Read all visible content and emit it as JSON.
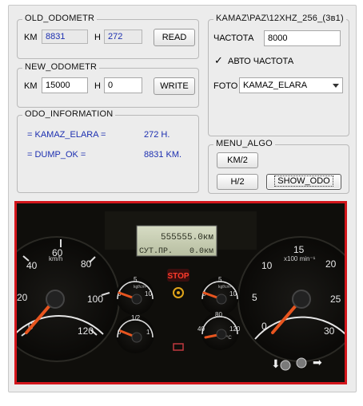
{
  "old_odometr": {
    "title": "OLD_ODOMETR",
    "km_label": "KM",
    "km_value": "8831",
    "h_label": "H",
    "h_value": "272",
    "read_button": "READ"
  },
  "new_odometr": {
    "title": "NEW_ODOMETR",
    "km_label": "KM",
    "km_value": "15000",
    "h_label": "H",
    "h_value": "0",
    "write_button": "WRITE"
  },
  "odo_information": {
    "title": "ODO_INFORMATION",
    "rows": [
      {
        "label": "= KAMAZ_ELARA =",
        "value": "272 H."
      },
      {
        "label": "= DUMP_OK =",
        "value": "8831 KM."
      }
    ]
  },
  "device": {
    "title": "KAMAZ\\PAZ\\12XHZ_256_(3в1)",
    "freq_label": "ЧАСТОТА",
    "freq_value": "8000",
    "auto_freq_label": "АВТО ЧАСТОТА",
    "auto_freq_checked": true,
    "foto_label": "FOTO",
    "foto_selected": "KAMAZ_ELARA"
  },
  "menu_algo": {
    "title": "MENU_ALGO",
    "km2_button": "KM/2",
    "h2_button": "H/2",
    "show_odo_button": "SHOW_ODO"
  },
  "dashboard": {
    "lcd_line1": "555555.0км",
    "lcd_line2_label": "СУТ.ПР.",
    "lcd_line2_value": "0.0км",
    "speed_unit": "km/h",
    "speed_ticks": [
      "0",
      "20",
      "40",
      "60",
      "80",
      "100",
      "120"
    ],
    "tacho_unit": "x100 min⁻¹",
    "tacho_ticks": [
      "0",
      "5",
      "10",
      "15",
      "20",
      "25",
      "30"
    ],
    "stop_label": "STOP",
    "pressure_unit": "kgf/cm²",
    "small_ticks_pressure": [
      "0",
      "5",
      "10"
    ],
    "fuel_ticks": [
      "0",
      "1/2",
      "1"
    ],
    "temp_ticks": [
      "40",
      "80",
      "120"
    ],
    "temp_unit": "°C",
    "accent_red": "#d3161c",
    "needle_color": "#e8551f"
  }
}
